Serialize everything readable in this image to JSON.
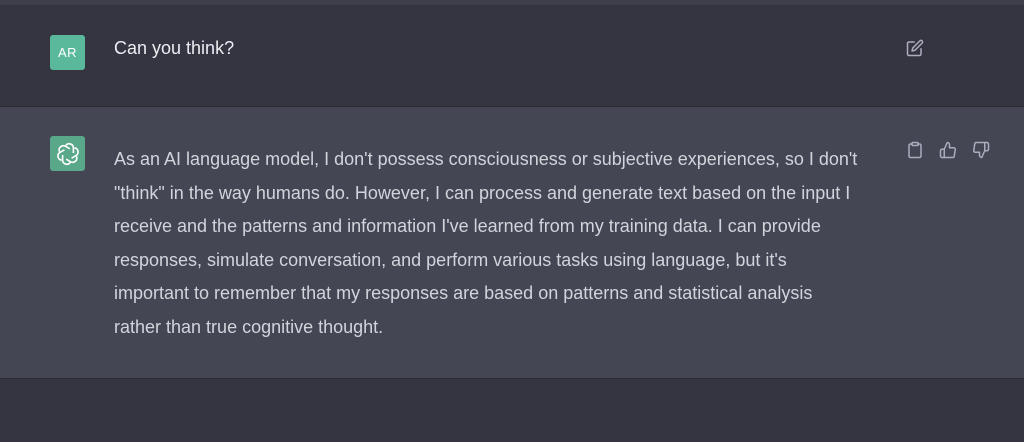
{
  "user_message": {
    "avatar_initials": "AR",
    "text": "Can you think?",
    "edit_icon": "edit-icon"
  },
  "assistant_message": {
    "logo": "openai-logo",
    "lines": [
      "As an AI language model, I don't possess consciousness or subjective experiences, so I don't",
      "\"think\" in the way humans do. However, I can process and generate text based on the input I",
      "receive and the patterns and information I've learned from my training data. I can provide",
      "responses, simulate conversation, and perform various tasks using language, but it's",
      "important to remember that my responses are based on patterns and statistical analysis",
      "rather than true cognitive thought."
    ],
    "actions": [
      "clipboard-icon",
      "thumbs-up-icon",
      "thumbs-down-icon"
    ]
  },
  "colors": {
    "page_bg": "#343541",
    "assistant_bg": "#444654",
    "user_avatar": "#5ab99b",
    "assistant_avatar": "#5aa88a",
    "text": "#ececf1"
  }
}
